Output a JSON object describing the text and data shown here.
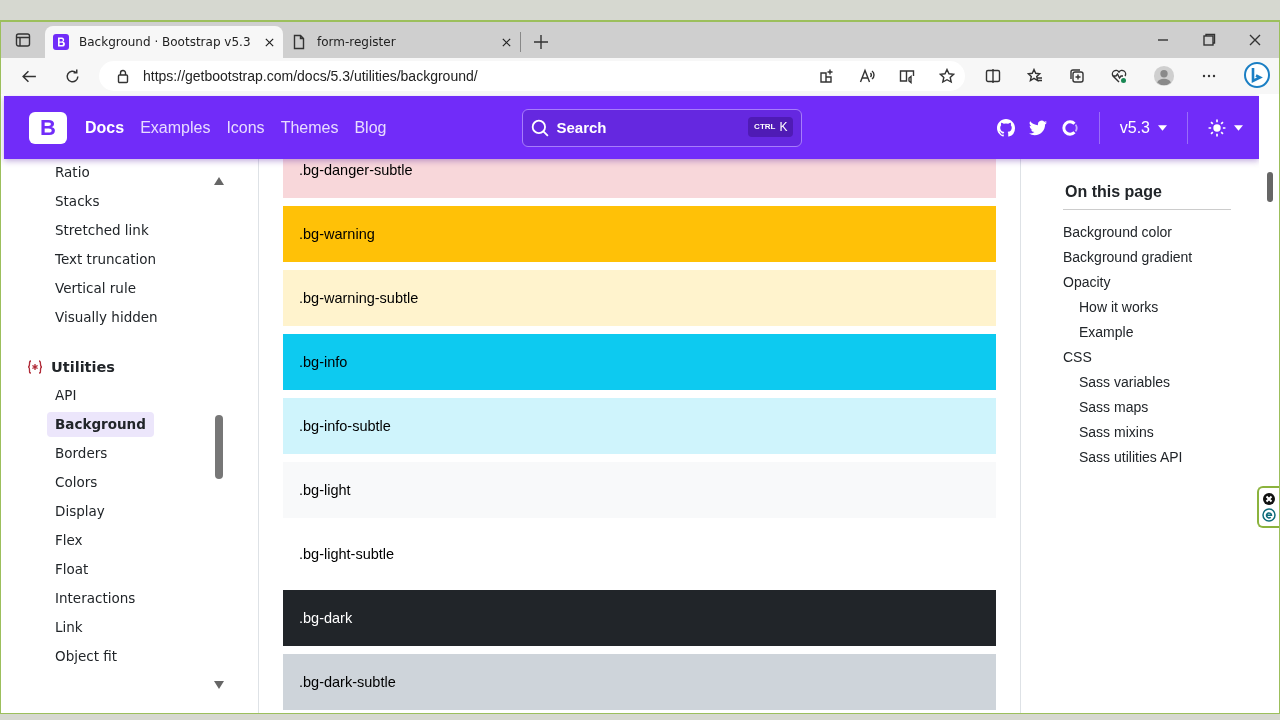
{
  "browser": {
    "tabs": [
      {
        "title": "Background · Bootstrap v5.3",
        "kind": "bootstrap",
        "selected": true
      },
      {
        "title": "form-register",
        "kind": "page",
        "selected": false
      }
    ],
    "url": "https://getbootstrap.com/docs/5.3/utilities/background/"
  },
  "navbar": {
    "logo": "B",
    "links": [
      {
        "label": "Docs",
        "selected": true
      },
      {
        "label": "Examples",
        "selected": false
      },
      {
        "label": "Icons",
        "selected": false
      },
      {
        "label": "Themes",
        "selected": false
      },
      {
        "label": "Blog",
        "selected": false
      }
    ],
    "search": {
      "placeholder": "Search",
      "keys": [
        "CTRL",
        "K"
      ]
    },
    "version": "v5.3",
    "dark_mode": false
  },
  "sidebar": {
    "items": [
      {
        "label": "Ratio",
        "selected": false
      },
      {
        "label": "Stacks",
        "selected": false
      },
      {
        "label": "Stretched link",
        "selected": false
      },
      {
        "label": "Text truncation",
        "selected": false
      },
      {
        "label": "Vertical rule",
        "selected": false
      },
      {
        "label": "Visually hidden",
        "selected": false
      }
    ],
    "groups": [
      {
        "title": "Utilities",
        "items": [
          {
            "label": "API",
            "selected": false
          },
          {
            "label": "Background",
            "selected": true
          },
          {
            "label": "Borders",
            "selected": false
          },
          {
            "label": "Colors",
            "selected": false
          },
          {
            "label": "Display",
            "selected": false
          },
          {
            "label": "Flex",
            "selected": false
          },
          {
            "label": "Float",
            "selected": false
          },
          {
            "label": "Interactions",
            "selected": false
          },
          {
            "label": "Link",
            "selected": false
          },
          {
            "label": "Object fit",
            "selected": false
          }
        ]
      }
    ]
  },
  "swatches": [
    {
      "label": ".bg-danger-subtle",
      "color": "#f8d7da"
    },
    {
      "label": ".bg-warning",
      "color": "#ffc107"
    },
    {
      "label": ".bg-warning-subtle",
      "color": "#fff3cd"
    },
    {
      "label": ".bg-info",
      "color": "#0dcaf0"
    },
    {
      "label": ".bg-info-subtle",
      "color": "#cff4fc"
    },
    {
      "label": ".bg-light",
      "color": "#f8f9fa"
    },
    {
      "label": ".bg-light-subtle",
      "color": "#ffffff"
    },
    {
      "label": ".bg-dark",
      "color": "#212529"
    },
    {
      "label": ".bg-dark-subtle",
      "color": "#ced4da"
    }
  ],
  "toc": {
    "title": "On this page",
    "items": [
      {
        "label": "Background color"
      },
      {
        "label": "Background gradient"
      },
      {
        "label": "Opacity",
        "children": [
          {
            "label": "How it works"
          },
          {
            "label": "Example"
          }
        ]
      },
      {
        "label": "CSS",
        "children": [
          {
            "label": "Sass variables"
          },
          {
            "label": "Sass maps"
          },
          {
            "label": "Sass mixins"
          },
          {
            "label": "Sass utilities API"
          }
        ]
      }
    ]
  }
}
